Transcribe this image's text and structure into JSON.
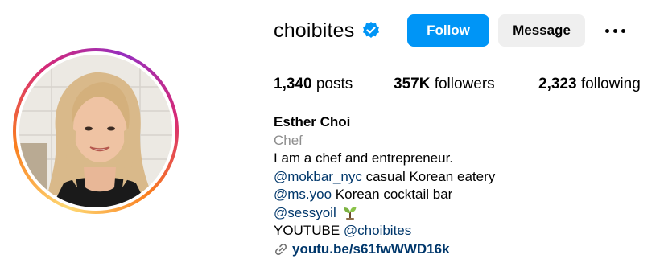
{
  "profile": {
    "username": "choibites",
    "verified": true,
    "follow_label": "Follow",
    "message_label": "Message",
    "more_icon": "more-horizontal-icon"
  },
  "stats": {
    "posts_count": "1,340",
    "posts_label": "posts",
    "followers_count": "357K",
    "followers_label": "followers",
    "following_count": "2,323",
    "following_label": "following"
  },
  "bio": {
    "full_name": "Esther Choi",
    "category": "Chef",
    "line1": "I am a chef and entrepreneur.",
    "mention1": "@mokbar_nyc",
    "line2_rest": " casual Korean eatery",
    "mention2": "@ms.yoo",
    "line3_rest": " Korean cocktail bar",
    "mention3": "@sessyoil",
    "line4_prefix": "YOUTUBE ",
    "mention4": "@choibites",
    "link": "youtu.be/s61fwWWD16k"
  },
  "colors": {
    "accent": "#0095f6",
    "link": "#00376b",
    "secondary_text": "#8e8e8e",
    "button_gray": "#efefef"
  }
}
